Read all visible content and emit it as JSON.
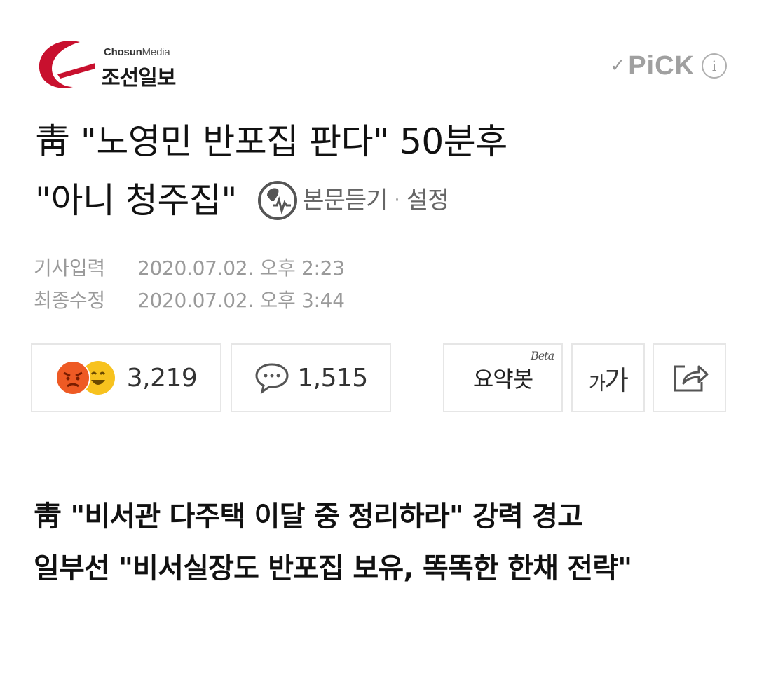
{
  "header": {
    "logo_sub_bold": "Chosun",
    "logo_sub": "Media",
    "logo_name": "조선일보",
    "pick_check_icon": "check-icon",
    "pick_label": "PiCK",
    "info_icon": "info-icon",
    "info_glyph": "i"
  },
  "article": {
    "headline_line1": "靑 \"노영민 반포집 판다\" 50분후",
    "headline_line2": "\"아니 청주집\"",
    "tts_label": "본문듣기",
    "tts_separator": "·",
    "settings_label": "설정",
    "meta": [
      {
        "label": "기사입력",
        "value": "2020.07.02. 오후 2:23"
      },
      {
        "label": "최종수정",
        "value": "2020.07.02. 오후 3:44"
      }
    ]
  },
  "actions": {
    "reaction_count": "3,219",
    "comment_count": "1,515",
    "summary_label": "요약봇",
    "summary_badge": "Beta",
    "font_small": "가",
    "font_large": "가",
    "share_icon": "share-icon"
  },
  "subheadlines": [
    "靑 \"비서관 다주택 이달 중 정리하라\" 강력 경고",
    "일부선 \"비서실장도 반포집 보유, 똑똑한 한채 전략\""
  ],
  "colors": {
    "brand_red": "#c8102e",
    "angry": "#ee5a24",
    "happy": "#f7c21e",
    "muted": "#9a9a9a"
  }
}
